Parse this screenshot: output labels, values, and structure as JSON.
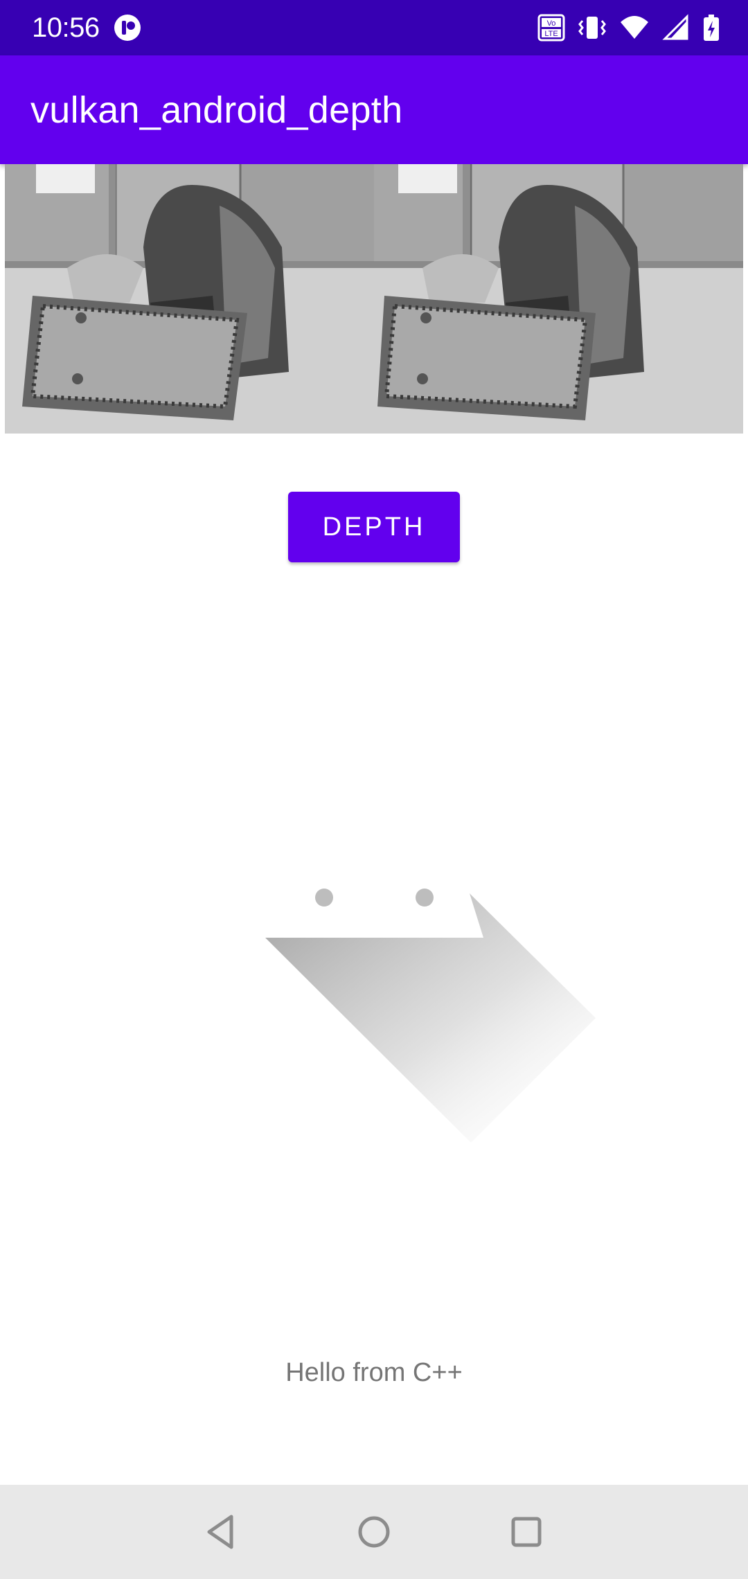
{
  "status_bar": {
    "time": "10:56",
    "icons": [
      "app-notification-icon",
      "volte-icon",
      "vibrate-icon",
      "wifi-icon",
      "signal-icon",
      "battery-charging-icon"
    ],
    "volte_label": "Vo LTE"
  },
  "app_bar": {
    "title": "vulkan_android_depth"
  },
  "images": {
    "left_alt": "left stereo image",
    "right_alt": "right stereo image"
  },
  "depth_button": {
    "label": "DEPTH"
  },
  "result": {
    "text": "Hello from C++"
  },
  "nav_bar": {
    "icons": [
      "back-icon",
      "home-icon",
      "recents-icon"
    ]
  },
  "colors": {
    "primary": "#6200ee",
    "primary_dark": "#3700b3",
    "nav_bg": "#e8e8e8"
  }
}
